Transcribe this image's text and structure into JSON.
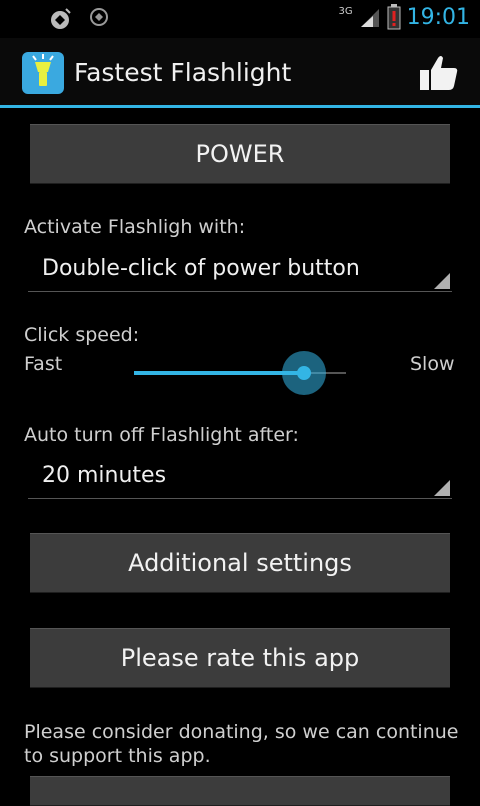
{
  "status_bar": {
    "network": "3G",
    "time": "19:01",
    "icons": [
      "notification-app-icon",
      "notification-app-icon-2",
      "signal-icon",
      "battery-alert-icon"
    ]
  },
  "action_bar": {
    "title": "Fastest Flashlight",
    "app_icon": "flashlight-icon",
    "rate_icon": "thumbs-up-icon"
  },
  "main": {
    "power_button": "POWER",
    "activate_label": "Activate Flashligh with:",
    "activate_value": "Double-click of power button",
    "click_speed_label": "Click speed:",
    "speed_min_label": "Fast",
    "speed_max_label": "Slow",
    "speed_value_fraction": 0.8,
    "auto_off_label": "Auto turn off Flashlight after:",
    "auto_off_value": "20 minutes",
    "additional_settings_button": "Additional settings",
    "rate_button": "Please rate this app",
    "donate_text": "Please consider donating, so we can continue to support this app."
  },
  "colors": {
    "accent": "#33b5e5",
    "button_bg": "#3c3c3c",
    "background": "#000000"
  }
}
